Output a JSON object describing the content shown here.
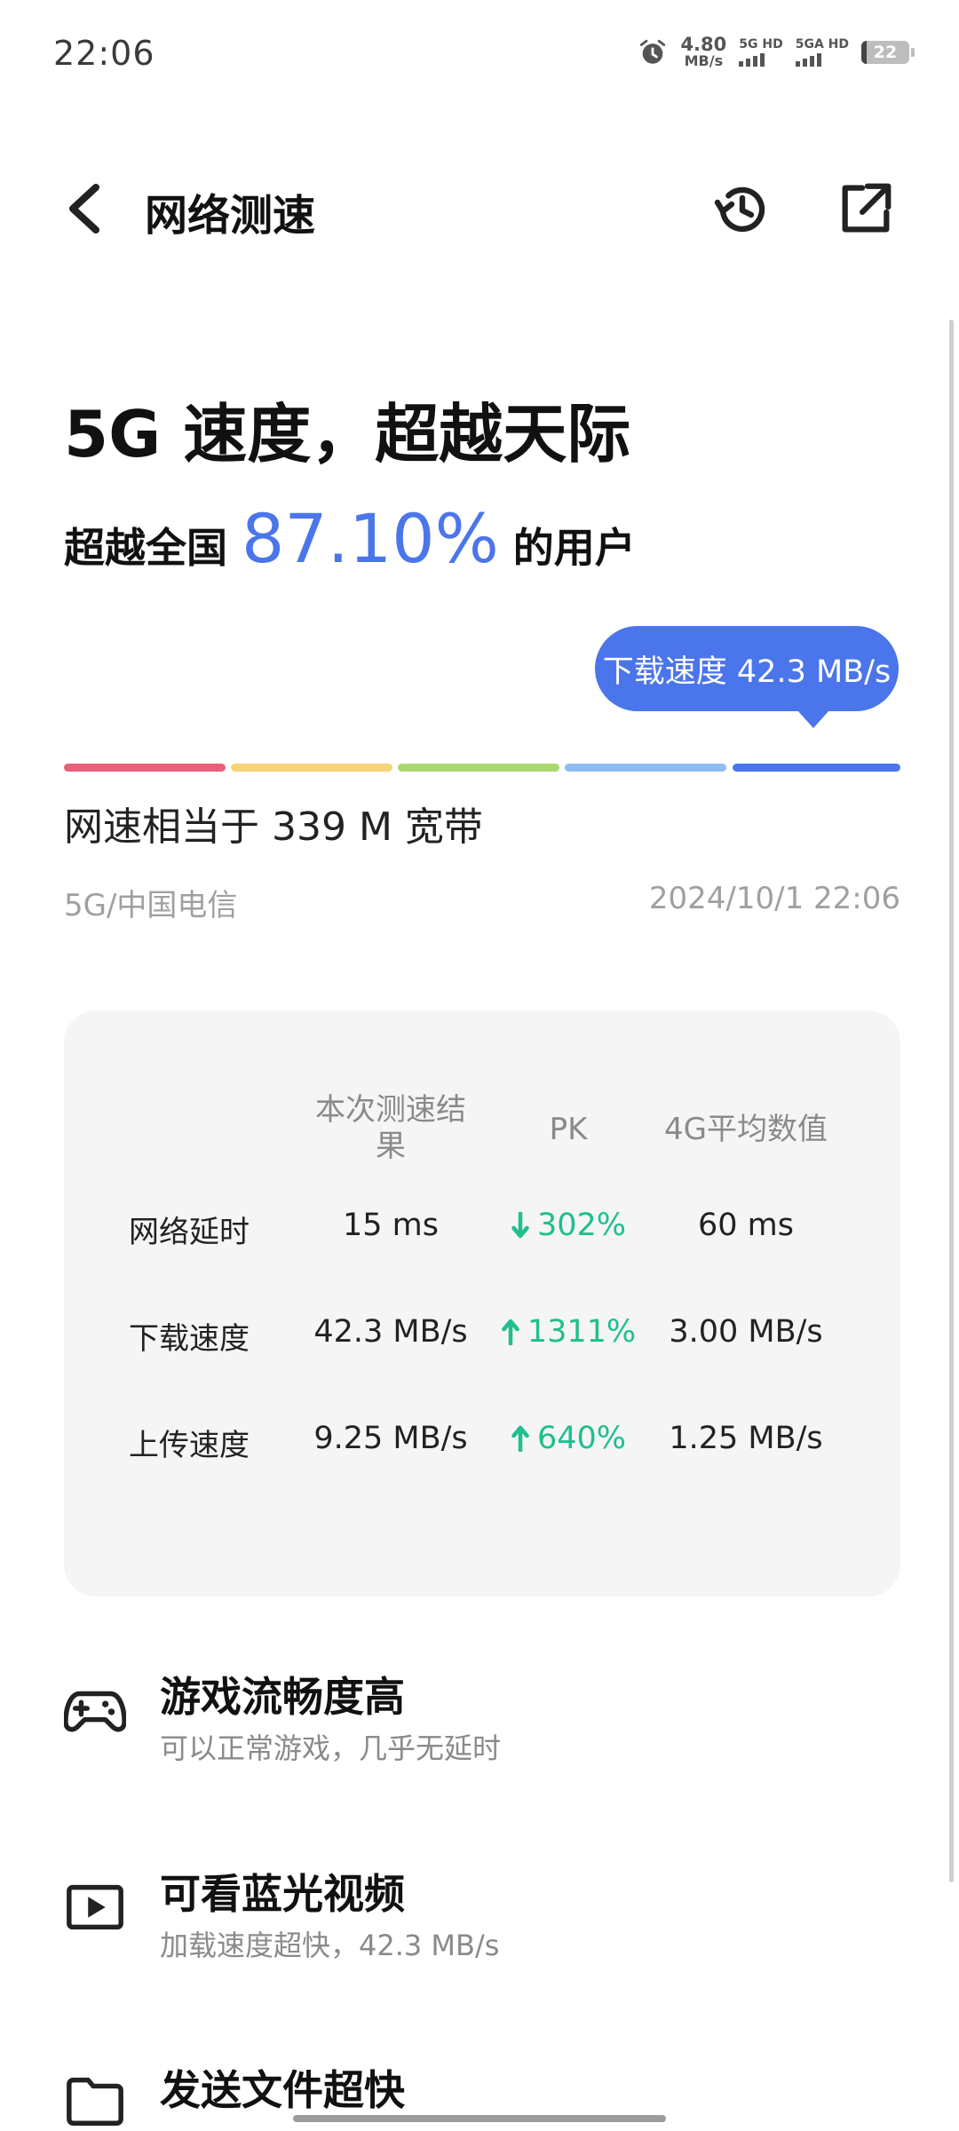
{
  "status": {
    "time": "22:06",
    "net_speed_value": "4.80",
    "net_speed_unit": "MB/s",
    "sim1": "5G HD",
    "sim2": "5GA HD",
    "battery": "22"
  },
  "header": {
    "title": "网络测速"
  },
  "result": {
    "headline": "5G 速度，超越天际",
    "beat_prefix": "超越全国",
    "beat_percent": "87.10%",
    "beat_suffix": "的用户",
    "bubble": "下载速度 42.3 MB/s",
    "level_colors": [
      "#e8607a",
      "#f5d47a",
      "#a9d870",
      "#8fbcf0",
      "#4b75ea"
    ],
    "equivalent": "网速相当于 339 M 宽带",
    "carrier": "5G/中国电信",
    "datetime": "2024/10/1 22:06"
  },
  "table": {
    "headers": {
      "current": "本次测速结果",
      "pk": "PK",
      "avg": "4G平均数值"
    },
    "rows": [
      {
        "label": "网络延时",
        "current": "15 ms",
        "pk": "302%",
        "direction": "down",
        "avg": "60 ms"
      },
      {
        "label": "下载速度",
        "current": "42.3 MB/s",
        "pk": "1311%",
        "direction": "up",
        "avg": "3.00 MB/s"
      },
      {
        "label": "上传速度",
        "current": "9.25 MB/s",
        "pk": "640%",
        "direction": "up",
        "avg": "1.25 MB/s"
      }
    ]
  },
  "features": [
    {
      "icon": "gamepad-icon",
      "title": "游戏流畅度高",
      "desc": "可以正常游戏，几乎无延时"
    },
    {
      "icon": "video-play-icon",
      "title": "可看蓝光视频",
      "desc": "加载速度超快，42.3 MB/s"
    },
    {
      "icon": "folder-icon",
      "title": "发送文件超快",
      "desc": ""
    }
  ],
  "colors": {
    "accent": "#4b75ea",
    "pk_green": "#1fbf8f"
  }
}
